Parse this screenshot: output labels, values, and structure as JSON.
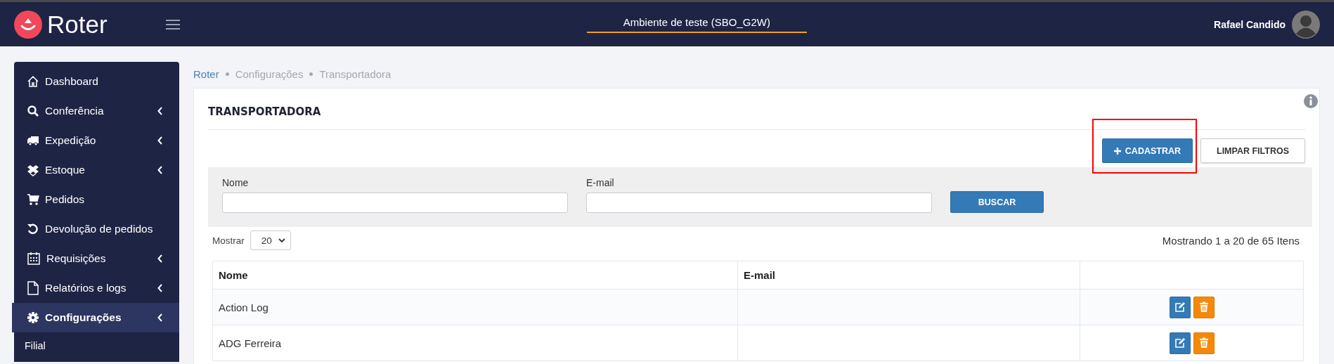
{
  "header": {
    "logo": "Roter",
    "environment": "Ambiente de teste (SBO_G2W)",
    "user": "Rafael Candido"
  },
  "sidebar": {
    "items": [
      {
        "label": "Dashboard",
        "expandable": false,
        "selected": false
      },
      {
        "label": "Conferência",
        "expandable": true,
        "selected": false
      },
      {
        "label": "Expedição",
        "expandable": true,
        "selected": false
      },
      {
        "label": "Estoque",
        "expandable": true,
        "selected": false
      },
      {
        "label": "Pedidos",
        "expandable": false,
        "selected": false
      },
      {
        "label": "Devolução de pedidos",
        "expandable": false,
        "selected": false
      },
      {
        "label": "Requisições",
        "expandable": true,
        "selected": false
      },
      {
        "label": "Relatórios e logs",
        "expandable": true,
        "selected": false
      },
      {
        "label": "Configurações",
        "expandable": true,
        "selected": true
      }
    ],
    "subitems": [
      {
        "label": "Filial"
      }
    ]
  },
  "breadcrumb": [
    {
      "label": "Roter",
      "link": true
    },
    {
      "label": "Configurações",
      "link": false
    },
    {
      "label": "Transportadora",
      "link": false
    }
  ],
  "page": {
    "title": "TRANSPORTADORA",
    "actions": [
      {
        "label": "CADASTRAR",
        "kind": "primary",
        "highlighted": true
      },
      {
        "label": "LIMPAR FILTROS",
        "kind": "default",
        "highlighted": false
      }
    ]
  },
  "filters": {
    "fields": [
      {
        "label": "Nome"
      },
      {
        "label": "E-mail"
      }
    ],
    "search_button": "BUSCAR"
  },
  "page_size": {
    "label": "Mostrar",
    "value": "20"
  },
  "summary": "Mostrando 1 a 20 de 65 Itens",
  "table": {
    "columns": [
      "Nome",
      "E-mail"
    ],
    "rows": [
      {
        "name": "Action Log"
      },
      {
        "name": "ADG Ferreira"
      }
    ]
  }
}
